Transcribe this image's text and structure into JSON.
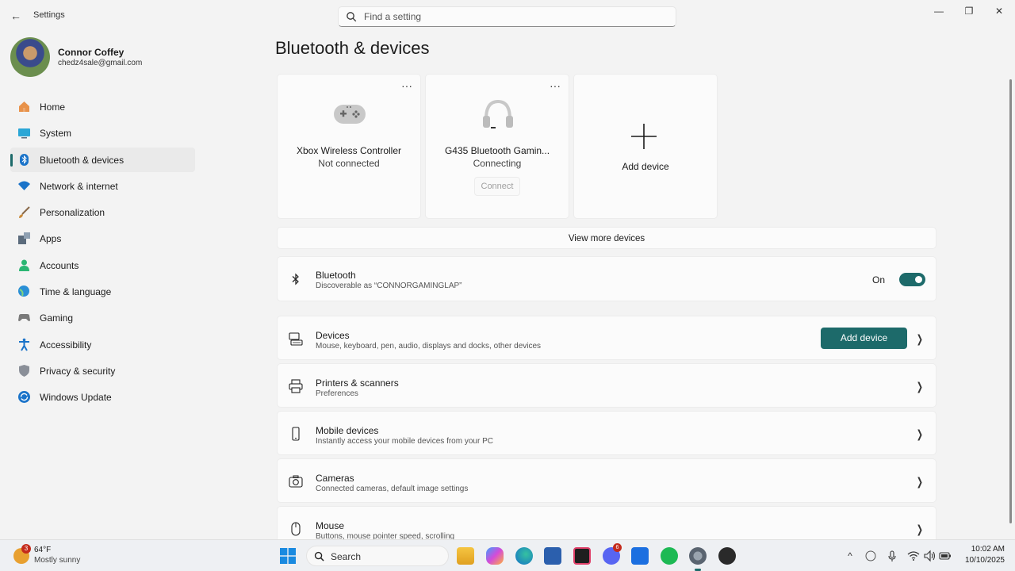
{
  "window": {
    "app_title": "Settings",
    "search_placeholder": "Find a setting",
    "back_glyph": "←",
    "controls": {
      "minimize": "—",
      "maximize": "❐",
      "close": "✕"
    }
  },
  "profile": {
    "name": "Connor Coffey",
    "email": "chedz4sale@gmail.com"
  },
  "sidebar": {
    "items": [
      {
        "label": "Home",
        "icon": "home-icon",
        "color": "#e07b39"
      },
      {
        "label": "System",
        "icon": "monitor-icon",
        "color": "#2aa6d6"
      },
      {
        "label": "Bluetooth & devices",
        "icon": "bluetooth-icon",
        "color": "#1a73c9",
        "active": true
      },
      {
        "label": "Network & internet",
        "icon": "wifi-icon",
        "color": "#1a73c9"
      },
      {
        "label": "Personalization",
        "icon": "brush-icon",
        "color": "#c98a3a"
      },
      {
        "label": "Apps",
        "icon": "apps-icon",
        "color": "#5b6b7c"
      },
      {
        "label": "Accounts",
        "icon": "person-icon",
        "color": "#2bb673"
      },
      {
        "label": "Time & language",
        "icon": "globe-clock-icon",
        "color": "#2a8fd6"
      },
      {
        "label": "Gaming",
        "icon": "controller-icon",
        "color": "#7a7a7a"
      },
      {
        "label": "Accessibility",
        "icon": "accessibility-icon",
        "color": "#1a73c9"
      },
      {
        "label": "Privacy & security",
        "icon": "shield-icon",
        "color": "#8a8f98"
      },
      {
        "label": "Windows Update",
        "icon": "sync-icon",
        "color": "#1a73c9"
      }
    ]
  },
  "main": {
    "title": "Bluetooth & devices",
    "cards": [
      {
        "name": "Xbox Wireless Controller",
        "status": "Not connected",
        "more": "···"
      },
      {
        "name": "G435 Bluetooth Gamin...",
        "status": "Connecting",
        "more": "···",
        "connect_label": "Connect"
      },
      {
        "add_label": "Add device"
      }
    ],
    "view_more": "View more devices",
    "bluetooth": {
      "title": "Bluetooth",
      "subtitle": "Discoverable as “CONNORGAMINGLAP”",
      "state": "On"
    },
    "rows": [
      {
        "title": "Devices",
        "subtitle": "Mouse, keyboard, pen, audio, displays and docks, other devices",
        "icon": "devices-icon",
        "button": "Add device"
      },
      {
        "title": "Printers & scanners",
        "subtitle": "Preferences",
        "icon": "printer-icon"
      },
      {
        "title": "Mobile devices",
        "subtitle": "Instantly access your mobile devices from your PC",
        "icon": "phone-icon"
      },
      {
        "title": "Cameras",
        "subtitle": "Connected cameras, default image settings",
        "icon": "camera-icon"
      },
      {
        "title": "Mouse",
        "subtitle": "Buttons, mouse pointer speed, scrolling",
        "icon": "mouse-icon"
      }
    ],
    "chevron": "❯"
  },
  "taskbar": {
    "weather": {
      "temp": "64°F",
      "desc": "Mostly sunny",
      "badge": "3"
    },
    "search_label": "Search",
    "apps": [
      "file-explorer-icon",
      "copilot-icon",
      "edge-icon",
      "store-icon",
      "instagram-icon",
      "discord-icon",
      "roblox-icon",
      "spotify-icon",
      "settings-icon",
      "obs-icon"
    ],
    "discord_badge": "6",
    "tray": {
      "chevron": "^"
    },
    "clock": {
      "time": "10:02 AM",
      "date": "10/10/2025"
    }
  },
  "colors": {
    "accent": "#1d6a6a",
    "background": "#f3f3f3",
    "card": "#fbfbfb"
  }
}
